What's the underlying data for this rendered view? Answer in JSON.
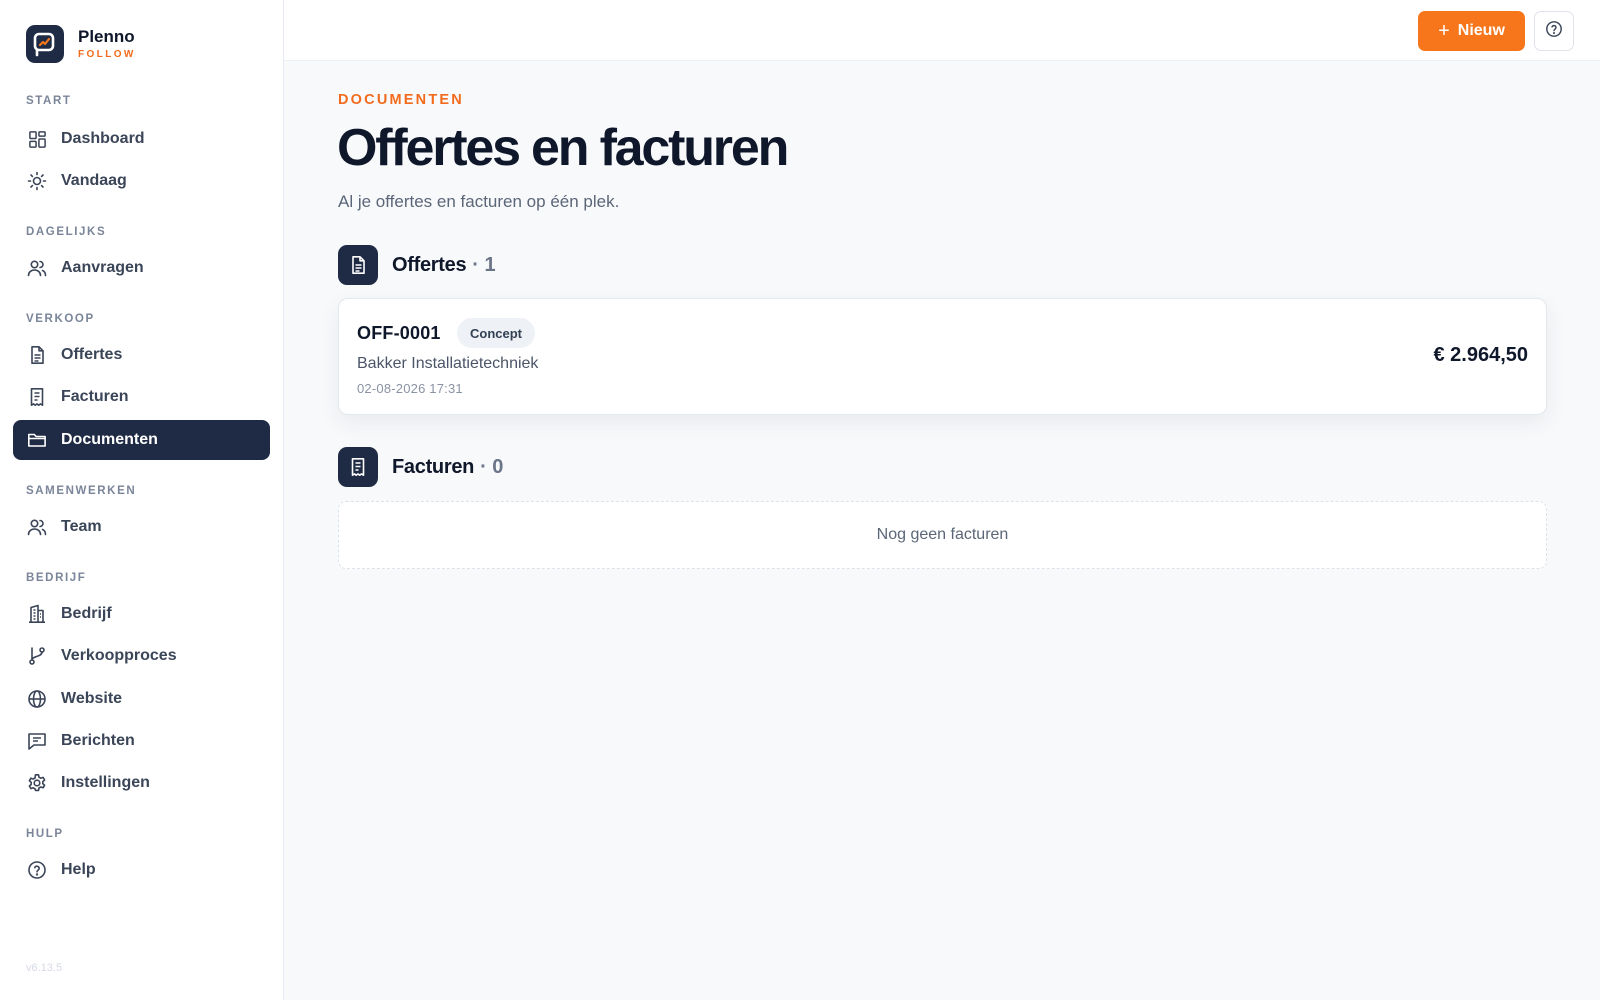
{
  "brand": {
    "name": "Plenno",
    "sub": "FOLLOW"
  },
  "sidebar": {
    "sections": [
      {
        "label": "START"
      },
      {
        "label": "DAGELIJKS"
      },
      {
        "label": "VERKOOP"
      },
      {
        "label": "SAMENWERKEN"
      },
      {
        "label": "BEDRIJF"
      },
      {
        "label": "HULP"
      }
    ],
    "items": [
      {
        "label": "Dashboard",
        "icon": "grid-icon"
      },
      {
        "label": "Vandaag",
        "icon": "sun-icon"
      },
      {
        "label": "Aanvragen",
        "icon": "users-icon"
      },
      {
        "label": "Offertes",
        "icon": "file-icon"
      },
      {
        "label": "Facturen",
        "icon": "receipt-icon"
      },
      {
        "label": "Documenten",
        "icon": "folder-icon",
        "active": true
      },
      {
        "label": "Team",
        "icon": "users-icon"
      },
      {
        "label": "Bedrijf",
        "icon": "building-icon"
      },
      {
        "label": "Verkoopproces",
        "icon": "git-branch-icon"
      },
      {
        "label": "Website",
        "icon": "globe-icon"
      },
      {
        "label": "Berichten",
        "icon": "message-icon"
      },
      {
        "label": "Instellingen",
        "icon": "gear-icon"
      },
      {
        "label": "Help",
        "icon": "help-circle-icon"
      }
    ],
    "version": "v6.13.5"
  },
  "topbar": {
    "new_label": "Nieuw"
  },
  "main": {
    "kicker": "DOCUMENTEN",
    "title": "Offertes en facturen",
    "subtitle": "Al je offertes en facturen op één plek.",
    "quotes": {
      "title": "Offertes",
      "count": "· 1",
      "items": [
        {
          "id": "OFF-0001",
          "status": "Concept",
          "client": "Bakker Installatietechniek",
          "date": "02-08-2026 17:31",
          "amount": "€ 2.964,50"
        }
      ]
    },
    "invoices": {
      "title": "Facturen",
      "count": "· 0",
      "empty": "Nog geen facturen"
    }
  },
  "colors": {
    "accent": "#f7761c",
    "navy": "#1f2a44",
    "background": "#f8f9fb"
  }
}
